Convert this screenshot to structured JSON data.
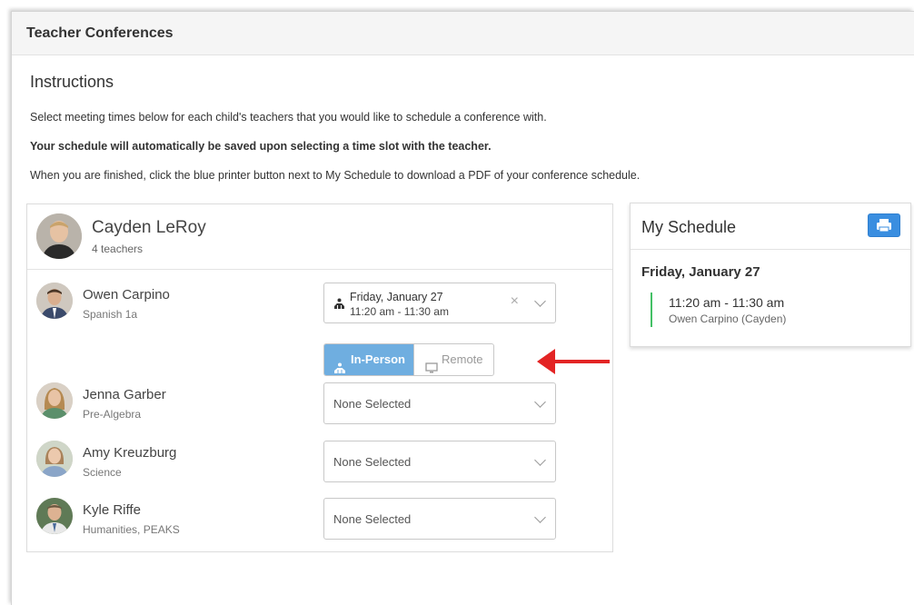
{
  "header": {
    "title": "Teacher Conferences"
  },
  "instructions": {
    "heading": "Instructions",
    "line1": "Select meeting times below for each child's teachers that you would like to schedule a conference with.",
    "line2": "Your schedule will automatically be saved upon selecting a time slot with the teacher.",
    "line3": "When you are finished, click the blue printer button next to My Schedule to download a PDF of your conference schedule."
  },
  "child": {
    "name": "Cayden LeRoy",
    "teacher_count": "4 teachers"
  },
  "teachers": [
    {
      "name": "Owen Carpino",
      "subject": "Spanish 1a",
      "selection": {
        "date": "Friday, January 27",
        "time": "11:20 am - 11:30 am",
        "clear": "×"
      },
      "mode": {
        "in_person": "In-Person",
        "remote": "Remote",
        "selected": "In-Person"
      }
    },
    {
      "name": "Jenna Garber",
      "subject": "Pre-Algebra",
      "placeholder": "None Selected"
    },
    {
      "name": "Amy Kreuzburg",
      "subject": "Science",
      "placeholder": "None Selected"
    },
    {
      "name": "Kyle Riffe",
      "subject": "Humanities, PEAKS",
      "placeholder": "None Selected"
    }
  ],
  "schedule": {
    "title": "My Schedule",
    "day": "Friday, January 27",
    "entries": [
      {
        "time": "11:20 am - 11:30 am",
        "detail": "Owen Carpino (Cayden)"
      }
    ]
  },
  "icons": {
    "print": "printer-icon",
    "in_person": "people-icon",
    "remote": "monitor-icon",
    "chevron": "chevron-down-icon",
    "annotation": "red-arrow-left"
  },
  "colors": {
    "accent_blue": "#3a8ee0",
    "toggle_active": "#6faee0",
    "schedule_bar": "#44c066",
    "arrow_red": "#e32424"
  }
}
